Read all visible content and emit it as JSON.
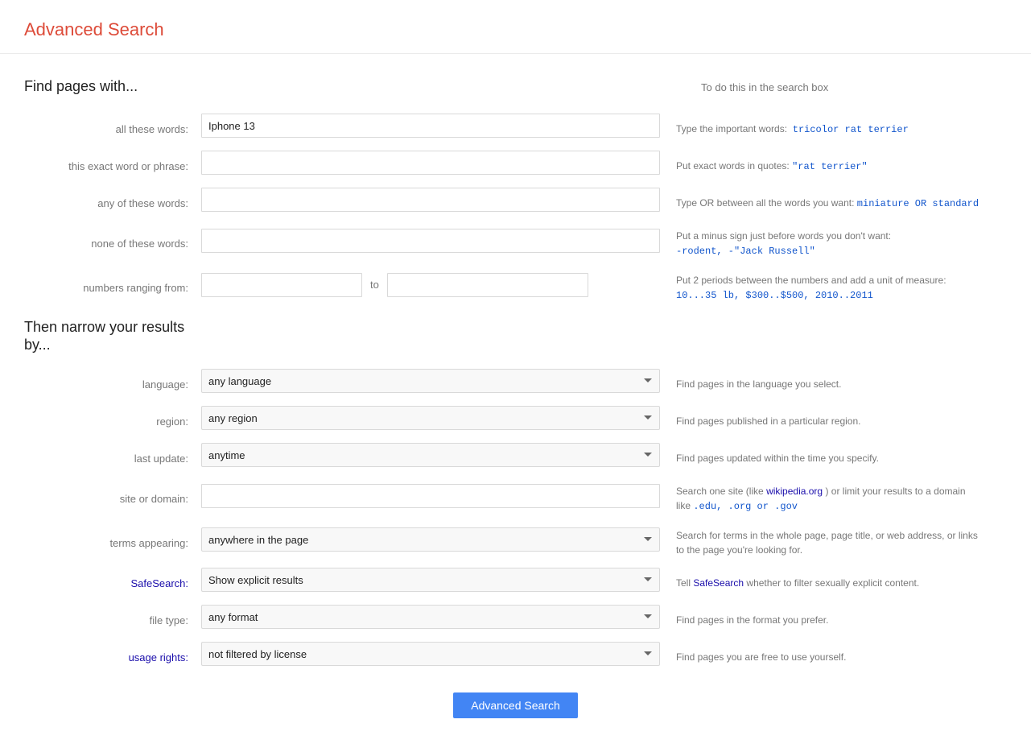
{
  "page": {
    "title": "Advanced Search"
  },
  "find_pages": {
    "heading": "Find pages with...",
    "todo_heading": "To do this in the search box"
  },
  "fields": {
    "all_words": {
      "label": "all these words:",
      "value": "Iphone 13",
      "help": "Type the important words:",
      "help_code": "tricolor rat terrier"
    },
    "exact_phrase": {
      "label": "this exact word or phrase:",
      "value": "",
      "help": "Put exact words in quotes:",
      "help_code": "\"rat terrier\""
    },
    "any_words": {
      "label": "any of these words:",
      "value": "",
      "help": "Type OR between all the words you want:",
      "help_code": "miniature OR standard"
    },
    "none_words": {
      "label": "none of these words:",
      "value": "",
      "help": "Put a minus sign just before words you don't want:",
      "help_code": "-rodent, -\"Jack Russell\""
    },
    "numbers_from": {
      "label": "numbers ranging from:",
      "value": "",
      "to": "to",
      "to_value": "",
      "help": "Put 2 periods between the numbers and add a unit of measure:",
      "help_code": "10...35 lb, $300..$500, 2010..2011"
    }
  },
  "narrow": {
    "heading_line1": "Then narrow your results",
    "heading_line2": "by..."
  },
  "dropdowns": {
    "language": {
      "label": "language:",
      "selected": "any language",
      "help": "Find pages in the language you select."
    },
    "region": {
      "label": "region:",
      "selected": "any region",
      "help": "Find pages published in a particular region."
    },
    "last_update": {
      "label": "last update:",
      "selected": "anytime",
      "help": "Find pages updated within the time you specify."
    },
    "site_domain": {
      "label": "site or domain:",
      "value": "",
      "help_line1": "Search one site (like",
      "help_site": "wikipedia.org",
      "help_line2": ") or limit your results to a domain like",
      "help_codes": ".edu, .org or .gov"
    },
    "terms_appearing": {
      "label": "terms appearing:",
      "selected": "anywhere in the page",
      "help_line1": "Search for terms in the whole page, page title, or web address, or links to the page you're looking for."
    },
    "safesearch": {
      "label": "SafeSearch:",
      "selected": "Show explicit results",
      "help_line1": "Tell SafeSearch whether to filter sexually explicit content."
    },
    "file_type": {
      "label": "file type:",
      "selected": "any format",
      "help": "Find pages in the format you prefer."
    },
    "usage_rights": {
      "label": "usage rights:",
      "selected": "not filtered by license",
      "help": "Find pages you are free to use yourself."
    }
  },
  "submit": {
    "label": "Advanced Search"
  }
}
